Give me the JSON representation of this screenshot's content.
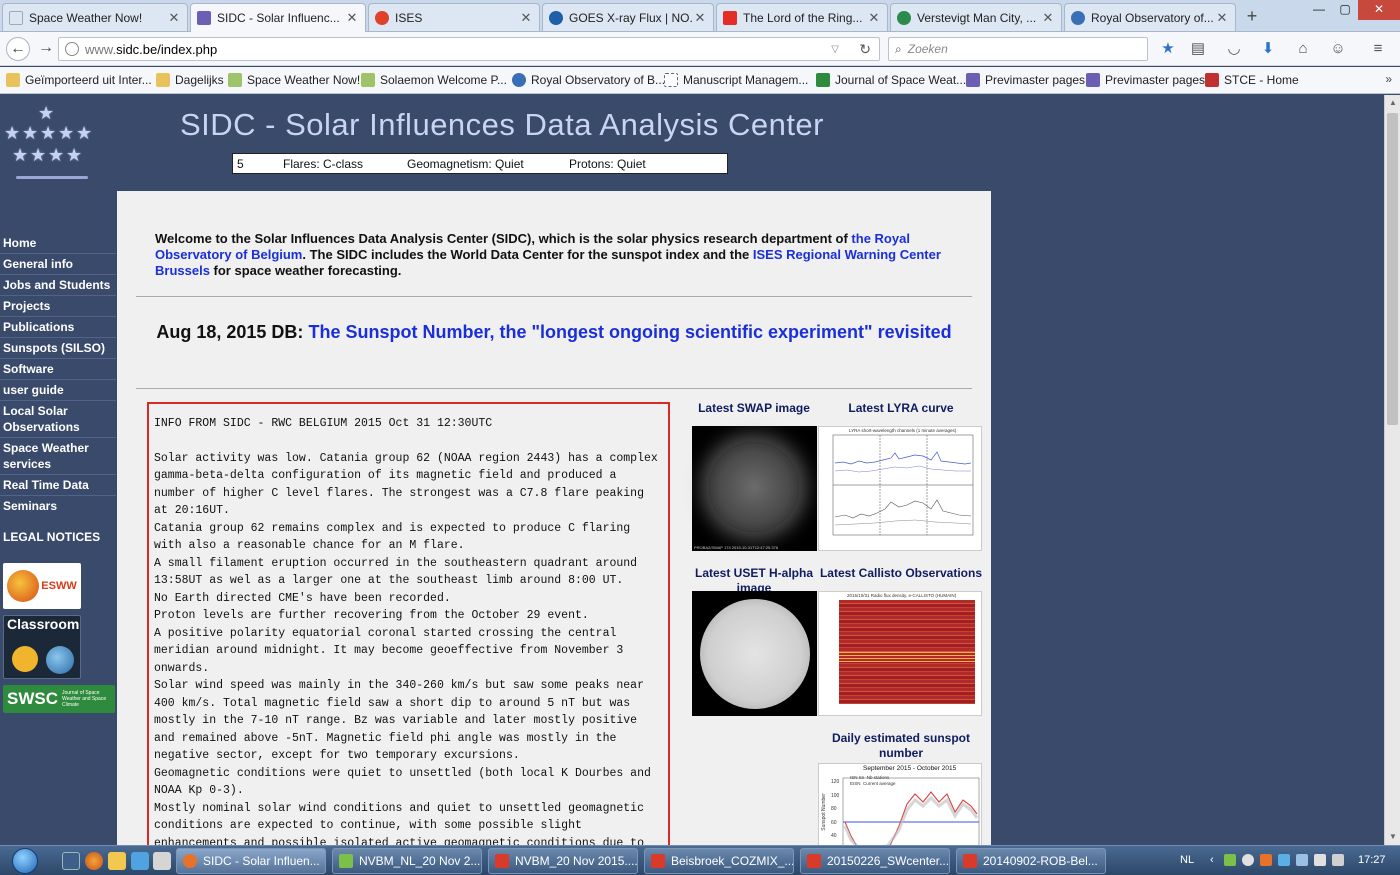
{
  "browser": {
    "tabs": [
      {
        "title": "Space Weather Now!",
        "active": false,
        "favicon_color": "#dbe6f2"
      },
      {
        "title": "SIDC - Solar Influenc...",
        "active": true,
        "favicon_color": "#6b5fb5"
      },
      {
        "title": "ISES",
        "active": false,
        "favicon_color": "#e0412a"
      },
      {
        "title": "GOES X-ray Flux | NO...",
        "active": false,
        "favicon_color": "#1f5fa8"
      },
      {
        "title": "The Lord of the Ring...",
        "active": false,
        "favicon_color": "#e52d27"
      },
      {
        "title": "Verstevigt Man City, ...",
        "active": false,
        "favicon_color": "#2c8a4f"
      },
      {
        "title": "Royal Observatory of...",
        "active": false,
        "favicon_color": "#3b6fb5"
      }
    ],
    "new_tab": "+",
    "window_controls": {
      "minimize": "—",
      "maximize": "▢",
      "close": "✕"
    },
    "url_host": "www.",
    "url_rest": "sidc.be/index.php",
    "search_placeholder": "Zoeken",
    "bookmarks": [
      {
        "label": "Geïmporteerd uit Inter...",
        "icon_color": "#e8c25a"
      },
      {
        "label": "Dagelijks",
        "icon_color": "#e8c25a"
      },
      {
        "label": "Space Weather Now!",
        "icon_color": "#9ec36b"
      },
      {
        "label": "Solaemon Welcome P...",
        "icon_color": "#9ec36b"
      },
      {
        "label": "Royal Observatory of B...",
        "icon_color": "#3b6fb5"
      },
      {
        "label": "Manuscript Managem...",
        "icon_color": "#ffffff"
      },
      {
        "label": "Journal of Space Weat...",
        "icon_color": "#2e8a3c"
      },
      {
        "label": "Previmaster pages",
        "icon_color": "#6b5fb5"
      },
      {
        "label": "Previmaster pages",
        "icon_color": "#6b5fb5"
      },
      {
        "label": "STCE - Home",
        "icon_color": "#c03030"
      }
    ],
    "bookmarks_more": "»"
  },
  "site": {
    "title": "SIDC - Solar Influences Data Analysis Center",
    "ticker": {
      "sunspot": "5",
      "flares": "Flares: C-class",
      "geomag": "Geomagnetism: Quiet",
      "protons": "Protons: Quiet"
    }
  },
  "nav": {
    "items": [
      "Home",
      "General info",
      "Jobs and Students",
      "Projects",
      "Publications",
      "Sunspots (SILSO)",
      "Software",
      "user guide",
      "Local Solar Observations",
      "Space Weather services",
      "Real Time Data",
      "Seminars"
    ],
    "legal": "LEGAL NOTICES",
    "badges": {
      "esww": "ESWW",
      "classroom": "Classroom",
      "swsc": "SWSC",
      "swsc_sub": "Journal of Space Weather and Space Climate"
    }
  },
  "welcome": {
    "p1": "Welcome to the Solar Influences Data Analysis Center (SIDC), which is the solar physics research department of ",
    "link1": "the Royal Observatory of Belgium",
    "p2": ". The SIDC includes the World Data Center for the sunspot index and the ",
    "link2": "ISES Regional Warning Center Brussels",
    "p3": " for space weather forecasting."
  },
  "headline": {
    "prefix": "Aug 18, 2015 DB:",
    "link": "The Sunspot Number, the \"longest ongoing scientific experiment\" revisited"
  },
  "bulletin": {
    "header": "INFO FROM SIDC - RWC BELGIUM 2015 Oct 31 12:30UTC",
    "text": "Solar activity was low. Catania group 62 (NOAA region 2443) has a complex gamma-beta-delta configuration of its magnetic field and produced a number of higher C level flares. The strongest was a C7.8 flare peaking at 20:16UT.\nCatania group 62 remains complex and is expected to produce C flaring with also a reasonable chance for an M flare.\nA small filament eruption occurred in the southeastern quadrant around 13:58UT as wel as a larger one at the southeast limb around 8:00 UT.\nNo Earth directed CME's have been recorded.\nProton levels are further recovering from the October 29 event.\nA positive polarity equatorial coronal started crossing the central meridian around midnight. It may become geoeffective from November 3 onwards.\nSolar wind speed was mainly in the 340-260 km/s but saw some peaks near 400 km/s. Total magnetic field saw a short dip to around 5 nT but was mostly in the 7-10 nT range. Bz was variable and later mostly positive and remained above -5nT. Magnetic field phi angle was mostly in the negative sector, except for two temporary excursions.\nGeomagnetic conditions were quiet to unsettled (both local K Dourbes and NOAA Kp 0-3).\nMostly nominal solar wind conditions and quiet to unsettled geomagnetic conditions are expected to continue, with some possible slight enhancements and possible isolated active geomagnetic conditions due to an expected"
  },
  "thumbs": {
    "swap": "Latest SWAP image",
    "lyra": "Latest LYRA curve",
    "uset": "Latest USET H-alpha image",
    "callisto": "Latest Callisto Observations",
    "sunspot": "Daily estimated sunspot number",
    "swap_caption": "PROBA2/SWAP 174   2015-10-31T12:47:25.376",
    "lyra_plot_title": "LYRA short-wavelength channels (1 minute averages)",
    "callisto_plot_title": "2015/10/31  Radio flux density, e-CALLISTO (HUMAIN)",
    "sunspot_plot_title": "September 2015 - October 2015",
    "sunspot_legend": [
      "ISN Sn",
      "Nb stations",
      "EISN",
      "Current average"
    ],
    "sunspot_yticks": [
      "120",
      "100",
      "80",
      "60",
      "40"
    ],
    "sunspot_ylabel": "Sunspot Number"
  },
  "taskbar": {
    "windows": [
      {
        "label": "SIDC - Solar Influen...",
        "icon_color": "#e8722a",
        "active": true
      },
      {
        "label": "NVBM_NL_20 Nov 2...",
        "icon_color": "#7cc04a",
        "active": false
      },
      {
        "label": "NVBM_20 Nov 2015....",
        "icon_color": "#d83b2a",
        "active": false
      },
      {
        "label": "Beisbroek_COZMIX_...",
        "icon_color": "#d83b2a",
        "active": false
      },
      {
        "label": "20150226_SWcenter...",
        "icon_color": "#d83b2a",
        "active": false
      },
      {
        "label": "20140902-ROB-Bel...",
        "icon_color": "#d83b2a",
        "active": false
      }
    ],
    "lang": "NL",
    "clock": "17:27"
  }
}
